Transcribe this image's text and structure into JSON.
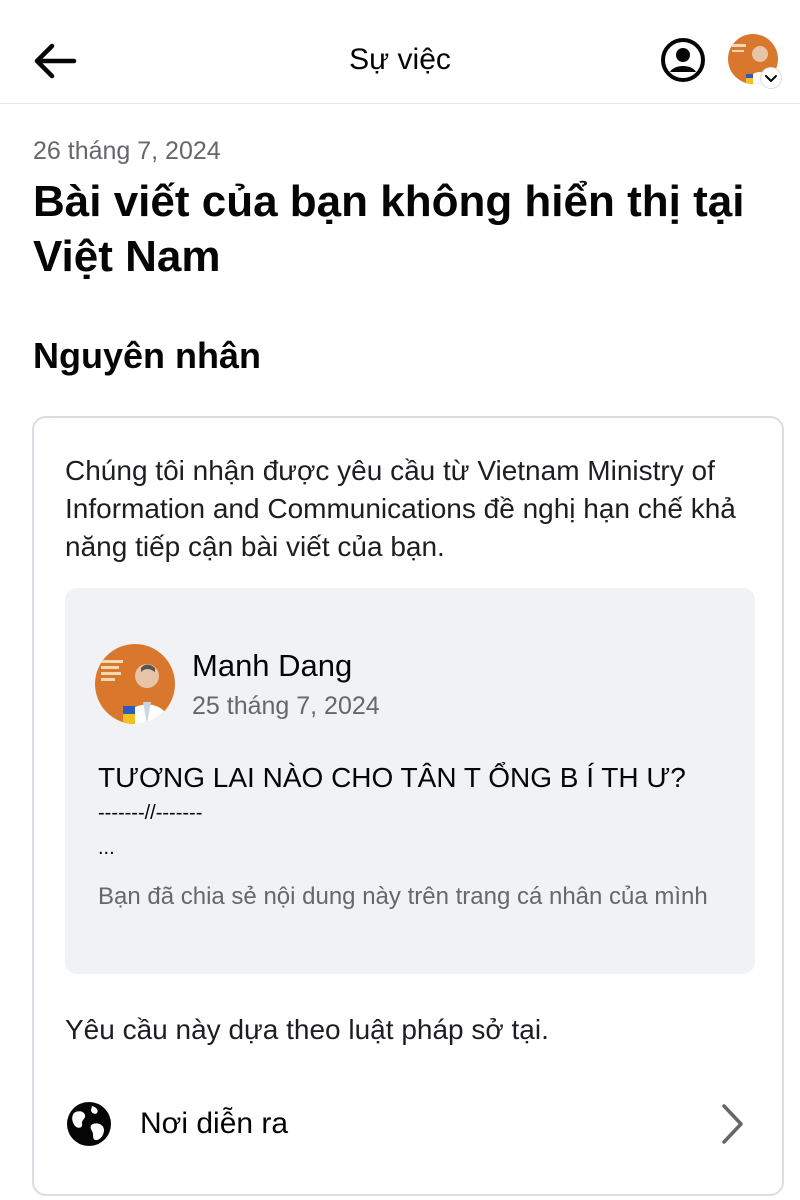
{
  "header": {
    "title": "Sự việc",
    "back_icon": "arrow-left-icon",
    "profile_icon": "user-circle-icon",
    "avatar_chevron_icon": "chevron-down-icon"
  },
  "event": {
    "date": "26 tháng 7, 2024",
    "headline": "Bài viết của bạn không hiển thị tại Việt Nam"
  },
  "reason": {
    "section_title": "Nguyên nhân",
    "description": "Chúng tôi nhận được yêu cầu từ Vietnam Ministry of Information and Communications đề nghị hạn chế khả năng tiếp cận bài viết của bạn.",
    "post": {
      "author": "Manh Dang",
      "date": "25 tháng 7, 2024",
      "headline": "TƯƠNG LAI NÀO CHO TÂN T ỔNG B Í TH Ư?",
      "separator": "-------//-------",
      "ellipsis": "...",
      "shared_note": "Bạn đã chia sẻ nội dung này trên trang cá nhân của mình"
    },
    "law_note": "Yêu cầu này dựa theo luật pháp sở tại.",
    "location": {
      "label": "Nơi diễn ra",
      "icon": "globe-icon",
      "chevron_icon": "chevron-right-icon"
    }
  },
  "colors": {
    "text_primary": "#050505",
    "text_secondary": "#65676b",
    "card_border": "#dadde1",
    "preview_bg": "#f0f2f5",
    "avatar_bg": "#d9782d"
  }
}
